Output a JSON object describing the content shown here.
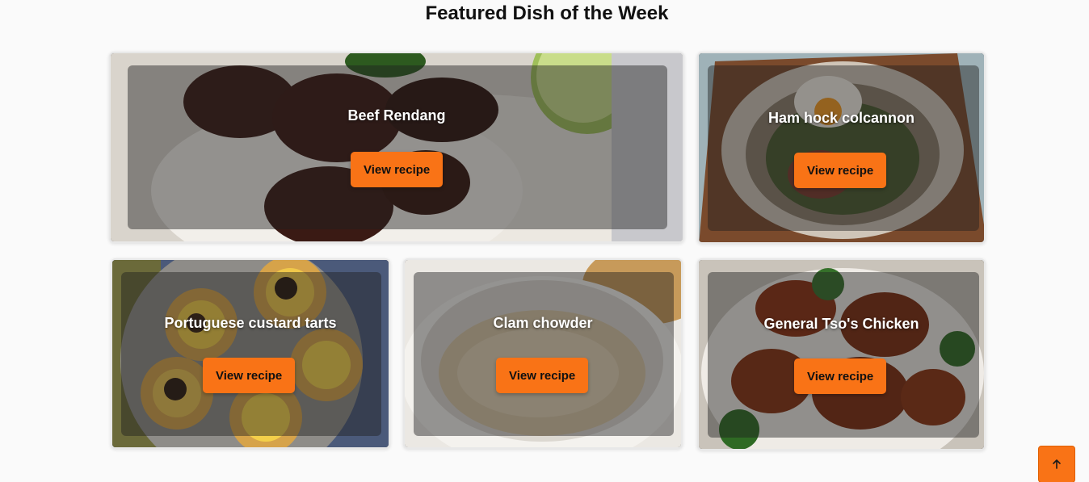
{
  "page": {
    "title": "Featured Dish of the Week"
  },
  "cards": [
    {
      "title": "Beef Rendang",
      "button_label": "View recipe",
      "image": "beef-rendang-rice-lime"
    },
    {
      "title": "Ham hock colcannon",
      "button_label": "View recipe",
      "image": "ham-hock-colcannon-bowl"
    },
    {
      "title": "Portuguese custard tarts",
      "button_label": "View recipe",
      "image": "custard-tarts-plate"
    },
    {
      "title": "Clam chowder",
      "button_label": "View recipe",
      "image": "clam-chowder-bowl"
    },
    {
      "title": "General Tso's Chicken",
      "button_label": "View recipe",
      "image": "general-tso-chicken-bowl"
    }
  ],
  "scroll_top": {
    "icon": "arrow-up-icon"
  },
  "colors": {
    "accent": "#f97316",
    "background": "#fafafa"
  }
}
